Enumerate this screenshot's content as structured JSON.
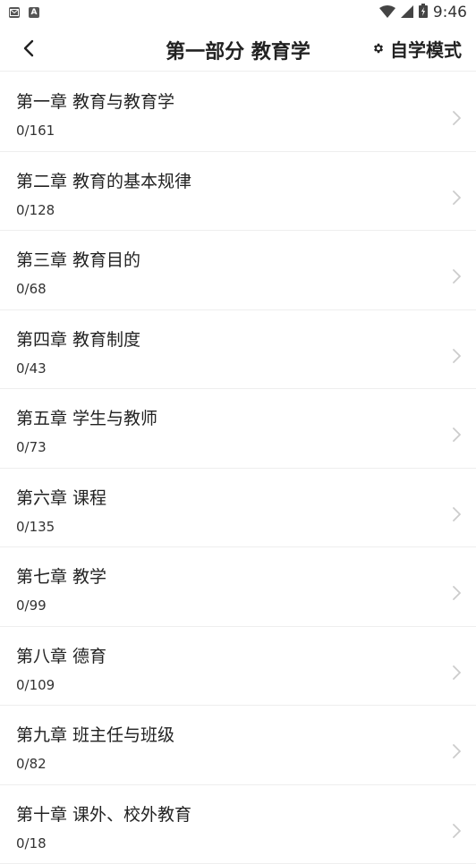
{
  "status_bar": {
    "time": "9:46",
    "notification_icons": [
      "mail-icon",
      "a-icon"
    ],
    "system_icons": [
      "wifi-icon",
      "signal-icon",
      "battery-charging-icon"
    ]
  },
  "header": {
    "title": "第一部分 教育学",
    "mode_label": "自学模式",
    "back_icon": "chevron-left-icon",
    "mode_icon": "gear-icon"
  },
  "chapters": [
    {
      "title": "第一章 教育与教育学",
      "progress": "0/161"
    },
    {
      "title": "第二章 教育的基本规律",
      "progress": "0/128"
    },
    {
      "title": "第三章 教育目的",
      "progress": "0/68"
    },
    {
      "title": "第四章 教育制度",
      "progress": "0/43"
    },
    {
      "title": "第五章 学生与教师",
      "progress": "0/73"
    },
    {
      "title": "第六章 课程",
      "progress": "0/135"
    },
    {
      "title": "第七章 教学",
      "progress": "0/99"
    },
    {
      "title": "第八章 德育",
      "progress": "0/109"
    },
    {
      "title": "第九章 班主任与班级",
      "progress": "0/82"
    },
    {
      "title": "第十章 课外、校外教育",
      "progress": "0/18"
    }
  ],
  "colors": {
    "text": "#222222",
    "divider": "#eeeeee",
    "chevron": "#cccccc"
  }
}
